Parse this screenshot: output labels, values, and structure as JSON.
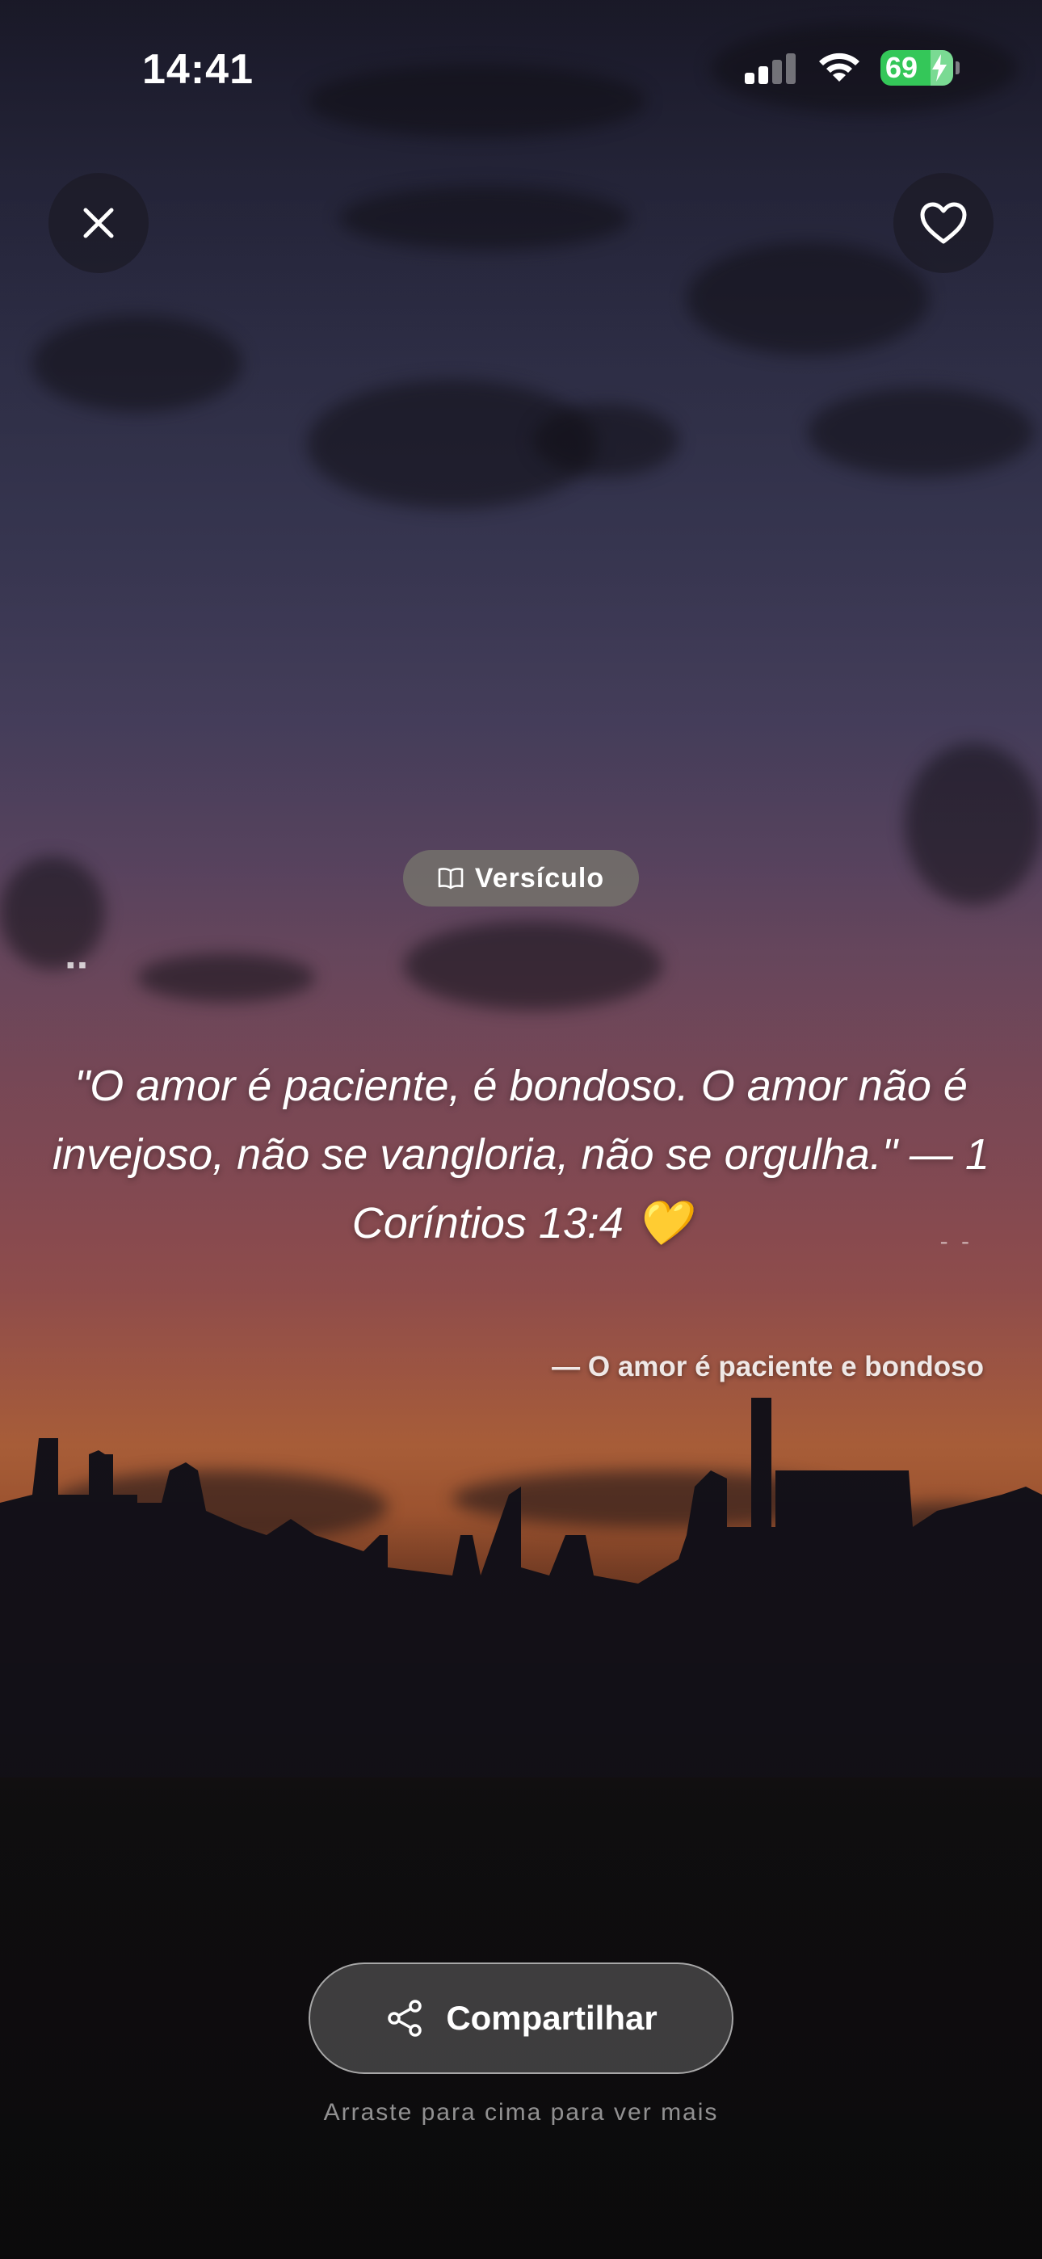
{
  "status_bar": {
    "time": "14:41",
    "battery_level": "69",
    "icons": [
      "cellular-signal-icon",
      "wifi-icon",
      "battery-charging-icon"
    ]
  },
  "top_bar": {
    "close_icon": "close-icon",
    "favorite_icon": "heart-icon"
  },
  "category": {
    "icon": "book-icon",
    "label": "Versículo"
  },
  "quote": {
    "text": "\"O amor é paciente, é bondoso. O amor não é invejoso, não se vangloria, não se orgulha.\" — 1 Coríntios 13:4 💛",
    "attribution": "— O amor é paciente e bondoso"
  },
  "share": {
    "icon": "share-icon",
    "label": "Compartilhar"
  },
  "hint": "Arraste para cima para ver mais",
  "colors": {
    "battery_green": "#34c759",
    "heart_emoji": "#f6c325"
  }
}
